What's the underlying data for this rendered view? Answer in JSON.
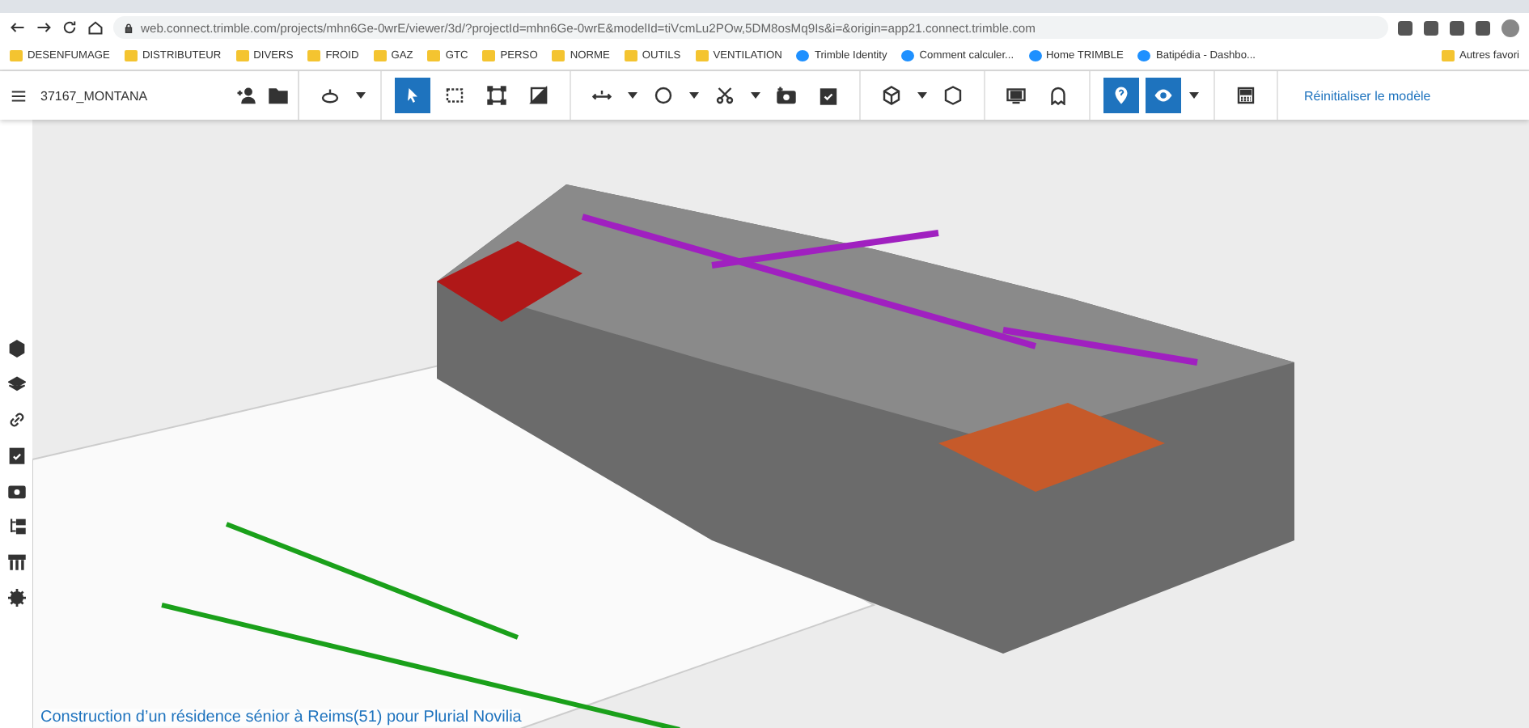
{
  "browser": {
    "url": "web.connect.trimble.com/projects/mhn6Ge-0wrE/viewer/3d/?projectId=mhn6Ge-0wrE&modelId=tiVcmLu2POw,5DM8osMq9Is&i=&origin=app21.connect.trimble.com"
  },
  "bookmarks": [
    {
      "kind": "folder",
      "label": "DESENFUMAGE"
    },
    {
      "kind": "folder",
      "label": "DISTRIBUTEUR"
    },
    {
      "kind": "folder",
      "label": "DIVERS"
    },
    {
      "kind": "folder",
      "label": "FROID"
    },
    {
      "kind": "folder",
      "label": "GAZ"
    },
    {
      "kind": "folder",
      "label": "GTC"
    },
    {
      "kind": "folder",
      "label": "PERSO"
    },
    {
      "kind": "folder",
      "label": "NORME"
    },
    {
      "kind": "folder",
      "label": "OUTILS"
    },
    {
      "kind": "folder",
      "label": "VENTILATION"
    },
    {
      "kind": "site",
      "label": "Trimble Identity"
    },
    {
      "kind": "site",
      "label": "Comment calculer..."
    },
    {
      "kind": "site",
      "label": "Home TRIMBLE"
    },
    {
      "kind": "site",
      "label": "Batipédia - Dashbo..."
    }
  ],
  "other_bookmarks": "Autres favori",
  "toolbar": {
    "project": "37167_MONTANA",
    "groups": [
      [
        {
          "selected": false,
          "dropdown": true
        }
      ],
      [
        {
          "selected": true,
          "dropdown": false
        },
        {
          "selected": false,
          "dropdown": false
        },
        {
          "selected": false,
          "dropdown": false
        },
        {
          "selected": false,
          "dropdown": false
        }
      ],
      [
        {
          "selected": false,
          "dropdown": true
        },
        {
          "selected": false,
          "dropdown": true
        },
        {
          "selected": false,
          "dropdown": true
        },
        {
          "selected": false,
          "dropdown": false
        },
        {
          "selected": false,
          "dropdown": false
        }
      ],
      [
        {
          "selected": false,
          "dropdown": true
        },
        {
          "selected": false,
          "dropdown": false
        }
      ],
      [
        {
          "selected": false,
          "dropdown": false
        },
        {
          "selected": false,
          "dropdown": false
        }
      ],
      [
        {
          "selected": true,
          "dropdown": false
        },
        {
          "selected": true,
          "dropdown": true
        }
      ],
      [
        {
          "selected": false,
          "dropdown": false
        }
      ]
    ],
    "reset_link": "Réinitialiser le modèle"
  },
  "caption": "Construction d’un résidence sénior à Reims(51) pour Plurial Novilia"
}
